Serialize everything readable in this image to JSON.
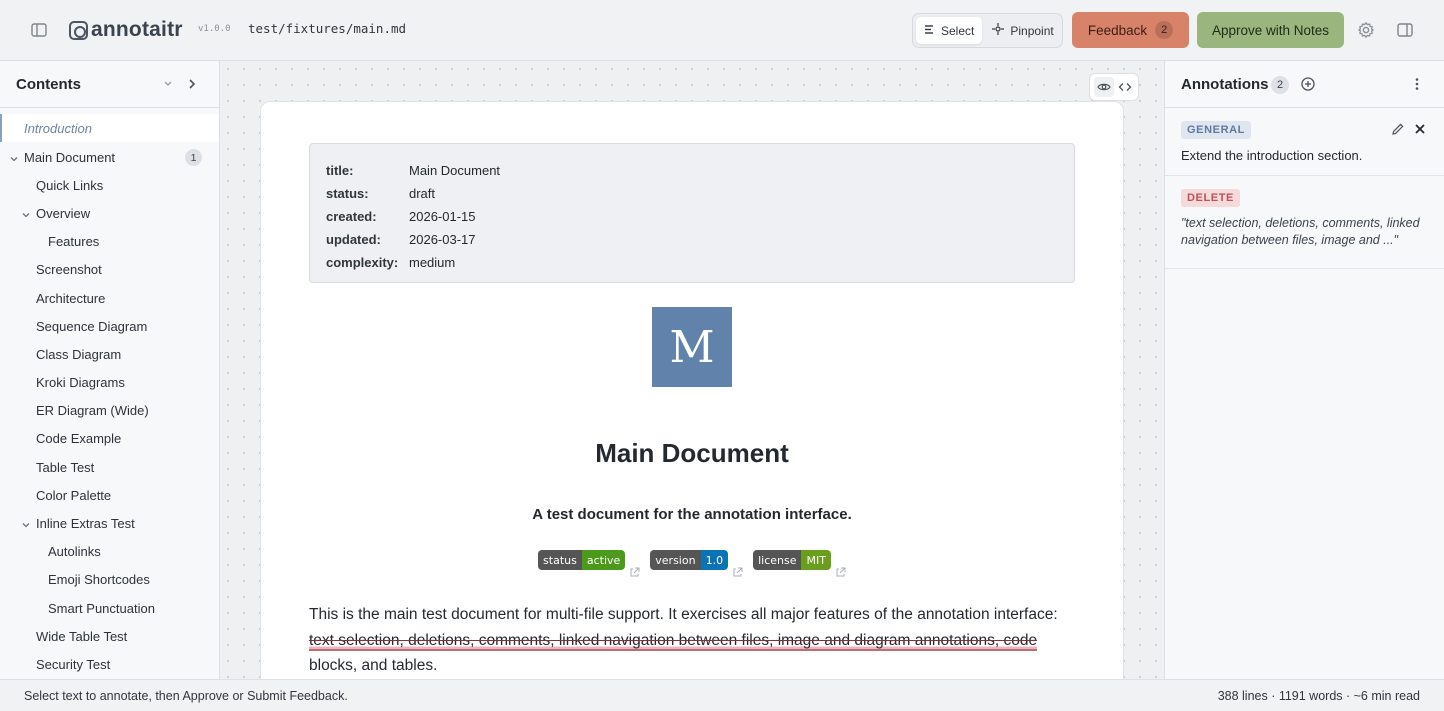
{
  "header": {
    "logo_text": "annotaitr",
    "version": "v1.0.0",
    "file_path": "test/fixtures/main.md",
    "modes": [
      {
        "label": "Select",
        "icon": "select-lines-icon",
        "active": true
      },
      {
        "label": "Pinpoint",
        "icon": "crosshair-icon",
        "active": false
      }
    ],
    "feedback_label": "Feedback",
    "feedback_count": "2",
    "approve_label": "Approve with Notes",
    "colors": {
      "feedback": "#d9826a",
      "approve": "#9ab57d"
    }
  },
  "sidebar": {
    "title": "Contents",
    "items": [
      {
        "label": "Introduction",
        "level": 0,
        "active": true
      },
      {
        "label": "Main Document",
        "level": 0,
        "expandable": true,
        "badge": "1"
      },
      {
        "label": "Quick Links",
        "level": 1
      },
      {
        "label": "Overview",
        "level": 1,
        "expandable": true
      },
      {
        "label": "Features",
        "level": 2
      },
      {
        "label": "Screenshot",
        "level": 1
      },
      {
        "label": "Architecture",
        "level": 1
      },
      {
        "label": "Sequence Diagram",
        "level": 1
      },
      {
        "label": "Class Diagram",
        "level": 1
      },
      {
        "label": "Kroki Diagrams",
        "level": 1
      },
      {
        "label": "ER Diagram (Wide)",
        "level": 1
      },
      {
        "label": "Code Example",
        "level": 1
      },
      {
        "label": "Table Test",
        "level": 1
      },
      {
        "label": "Color Palette",
        "level": 1
      },
      {
        "label": "Inline Extras Test",
        "level": 1,
        "expandable": true
      },
      {
        "label": "Autolinks",
        "level": 2
      },
      {
        "label": "Emoji Shortcodes",
        "level": 2
      },
      {
        "label": "Smart Punctuation",
        "level": 2
      },
      {
        "label": "Wide Table Test",
        "level": 1
      },
      {
        "label": "Security Test",
        "level": 1
      }
    ]
  },
  "document": {
    "frontmatter": [
      {
        "key": "title:",
        "value": "Main Document"
      },
      {
        "key": "status:",
        "value": "draft"
      },
      {
        "key": "created:",
        "value": "2026-01-15"
      },
      {
        "key": "updated:",
        "value": "2026-03-17"
      },
      {
        "key": "complexity:",
        "value": "medium"
      }
    ],
    "hero_letter": "M",
    "hero_color": "#6183ab",
    "title": "Main Document",
    "subtitle": "A test document for the annotation interface.",
    "badges": [
      {
        "left": "status",
        "right": "active",
        "color": "#4c9a1c"
      },
      {
        "left": "version",
        "right": "1.0",
        "color": "#0a73b6"
      },
      {
        "left": "license",
        "right": "MIT",
        "color": "#6a9e1d"
      }
    ],
    "paragraph_start": "This is the main test document for multi-file support. It exercises all major features of the annotation interface: ",
    "paragraph_deleted": "text selection, deletions, comments, linked navigation between files, image and diagram annotations, code",
    "paragraph_end": " blocks, and tables."
  },
  "annotations": {
    "title": "Annotations",
    "count": "2",
    "items": [
      {
        "type": "GENERAL",
        "text": "Extend the introduction section."
      },
      {
        "type": "DELETE",
        "quote": "\"text selection, deletions, comments, linked navigation between files, image and ...\""
      }
    ]
  },
  "status": {
    "hint": "Select text to annotate, then Approve or Submit Feedback.",
    "stats": "388 lines · 1191 words · ~6 min read"
  }
}
